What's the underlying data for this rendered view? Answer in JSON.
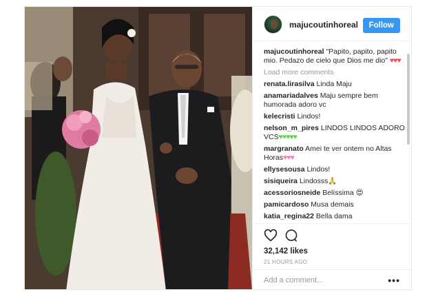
{
  "post": {
    "username": "majucoutinhoreal",
    "follow_label": "Follow",
    "caption_user": "majucoutinhoreal",
    "caption_text": "\"Papito, papito, papito mio. Pedazo de cielo que Dios me dio\"",
    "caption_hearts": "♥♥♥",
    "load_more": "Load more comments",
    "likes": "32,142 likes",
    "time": "21 HOURS AGO",
    "add_comment_placeholder": "Add a comment...",
    "more_glyph": "•••"
  },
  "comments": [
    {
      "user": "renata.lirasilva",
      "text": "Linda Maju",
      "extra": ""
    },
    {
      "user": "anamariadalves",
      "text": "Maju sempre bem humorada adoro vc",
      "extra": ""
    },
    {
      "user": "kelecristi",
      "text": "Lindos!",
      "extra": ""
    },
    {
      "user": "nelson_m_pires",
      "text": "LINDOS LINDOS ADORO VCS",
      "extra": "♥♥♥♥♥"
    },
    {
      "user": "margranato",
      "text": "Amei te ver ontem no Altas Horas",
      "extra": "♥♥♥"
    },
    {
      "user": "ellysesousa",
      "text": "Lindos!",
      "extra": ""
    },
    {
      "user": "sisiqueira",
      "text": "Lindosss",
      "extra": "🙏"
    },
    {
      "user": "acessoriosneide",
      "text": "Belíssima",
      "extra": "😍"
    },
    {
      "user": "pamicardoso",
      "text": "Musa demais",
      "extra": ""
    },
    {
      "user": "katia_regina22",
      "text": "Bella dama",
      "extra": ""
    }
  ],
  "icons": {
    "like": "heart-icon",
    "comment": "comment-bubble-icon",
    "more": "more-options-icon"
  },
  "colors": {
    "follow_button": "#3897f0",
    "username_text": "#262626",
    "muted_text": "#999999",
    "like_heart": "#ed4956"
  }
}
